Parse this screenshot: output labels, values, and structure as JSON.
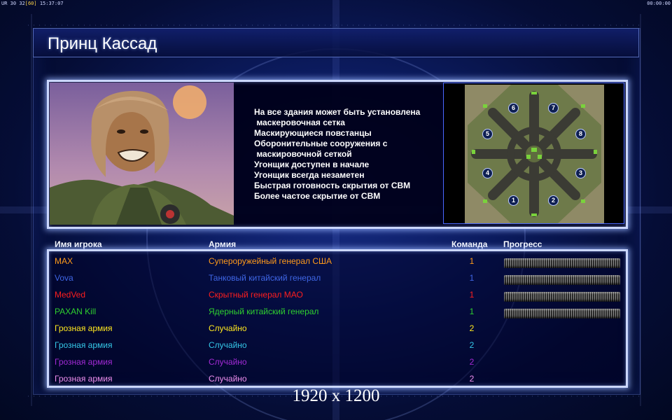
{
  "hud": {
    "prefix": "UR",
    "a": "30",
    "b": "32",
    "fps": "[60]",
    "clock": "15:37:07",
    "timer": "00:00:00"
  },
  "screen": {
    "title": "Принц Кассад",
    "resolution": "1920 x 1200"
  },
  "general": {
    "features": [
      "На все здания может быть установлена",
      " маскеровочная сетка",
      "Маскирующиеся повстанцы",
      "Оборонительные сооружения с",
      " маскировочной сеткой",
      "Угонщик доступен в начале",
      "Угонщик всегда незаметен",
      "Быстрая готовность скрытия от СВМ",
      "Более частое скрытие от СВМ"
    ]
  },
  "map": {
    "slots": [
      "1",
      "2",
      "3",
      "4",
      "5",
      "6",
      "7",
      "8"
    ]
  },
  "table": {
    "columns": {
      "name": "Имя игрока",
      "army": "Армия",
      "team": "Команда",
      "progress": "Прогресс"
    },
    "rows": [
      {
        "name": "MAX",
        "army": "Супероружейный генерал США",
        "team": "1",
        "color": "#ff9a1a",
        "progress": 1
      },
      {
        "name": "Vova",
        "army": "Танковый китайский генерал",
        "team": "1",
        "color": "#3f66e6",
        "progress": 1
      },
      {
        "name": "MedVed",
        "army": "Скрытный генерал МАО",
        "team": "1",
        "color": "#ff1e1e",
        "progress": 1
      },
      {
        "name": "PAXAN Kill",
        "army": "Ядерный китайский генерал",
        "team": "1",
        "color": "#2fcf2f",
        "progress": 1
      },
      {
        "name": "Грозная армия",
        "army": "Случайно",
        "team": "2",
        "color": "#ffe81f",
        "progress": null
      },
      {
        "name": "Грозная армия",
        "army": "Случайно",
        "team": "2",
        "color": "#35c8e8",
        "progress": null
      },
      {
        "name": "Грозная армия",
        "army": "Случайно",
        "team": "2",
        "color": "#a32ad6",
        "progress": null
      },
      {
        "name": "Грозная армия",
        "army": "Случайно",
        "team": "2",
        "color": "#f08ff0",
        "progress": null
      }
    ]
  }
}
